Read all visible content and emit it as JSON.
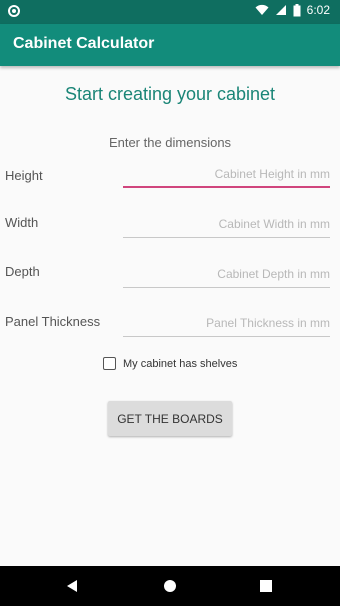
{
  "status_bar": {
    "time": "6:02",
    "icons": [
      "circle-notification-icon",
      "wifi-icon",
      "signal-icon",
      "battery-icon"
    ]
  },
  "app_bar": {
    "title": "Cabinet Calculator"
  },
  "main": {
    "heading": "Start creating your cabinet",
    "subheading": "Enter the dimensions",
    "fields": [
      {
        "label": "Height",
        "placeholder": "Cabinet Height in mm",
        "value": ""
      },
      {
        "label": "Width",
        "placeholder": "Cabinet Width in mm",
        "value": ""
      },
      {
        "label": "Depth",
        "placeholder": "Cabinet Depth in mm",
        "value": ""
      },
      {
        "label": "Panel Thickness",
        "placeholder": "Panel Thickness in mm",
        "value": ""
      }
    ],
    "shelves_checkbox": {
      "label": "My cabinet has shelves",
      "checked": false
    },
    "button_label": "GET THE BOARDS"
  },
  "nav_bar": {
    "icons": [
      "back-icon",
      "home-icon",
      "recents-icon"
    ]
  },
  "colors": {
    "status_bar": "#0f6e60",
    "app_bar": "#128c7b",
    "heading": "#1a8577",
    "focus_underline": "#d0457d"
  }
}
